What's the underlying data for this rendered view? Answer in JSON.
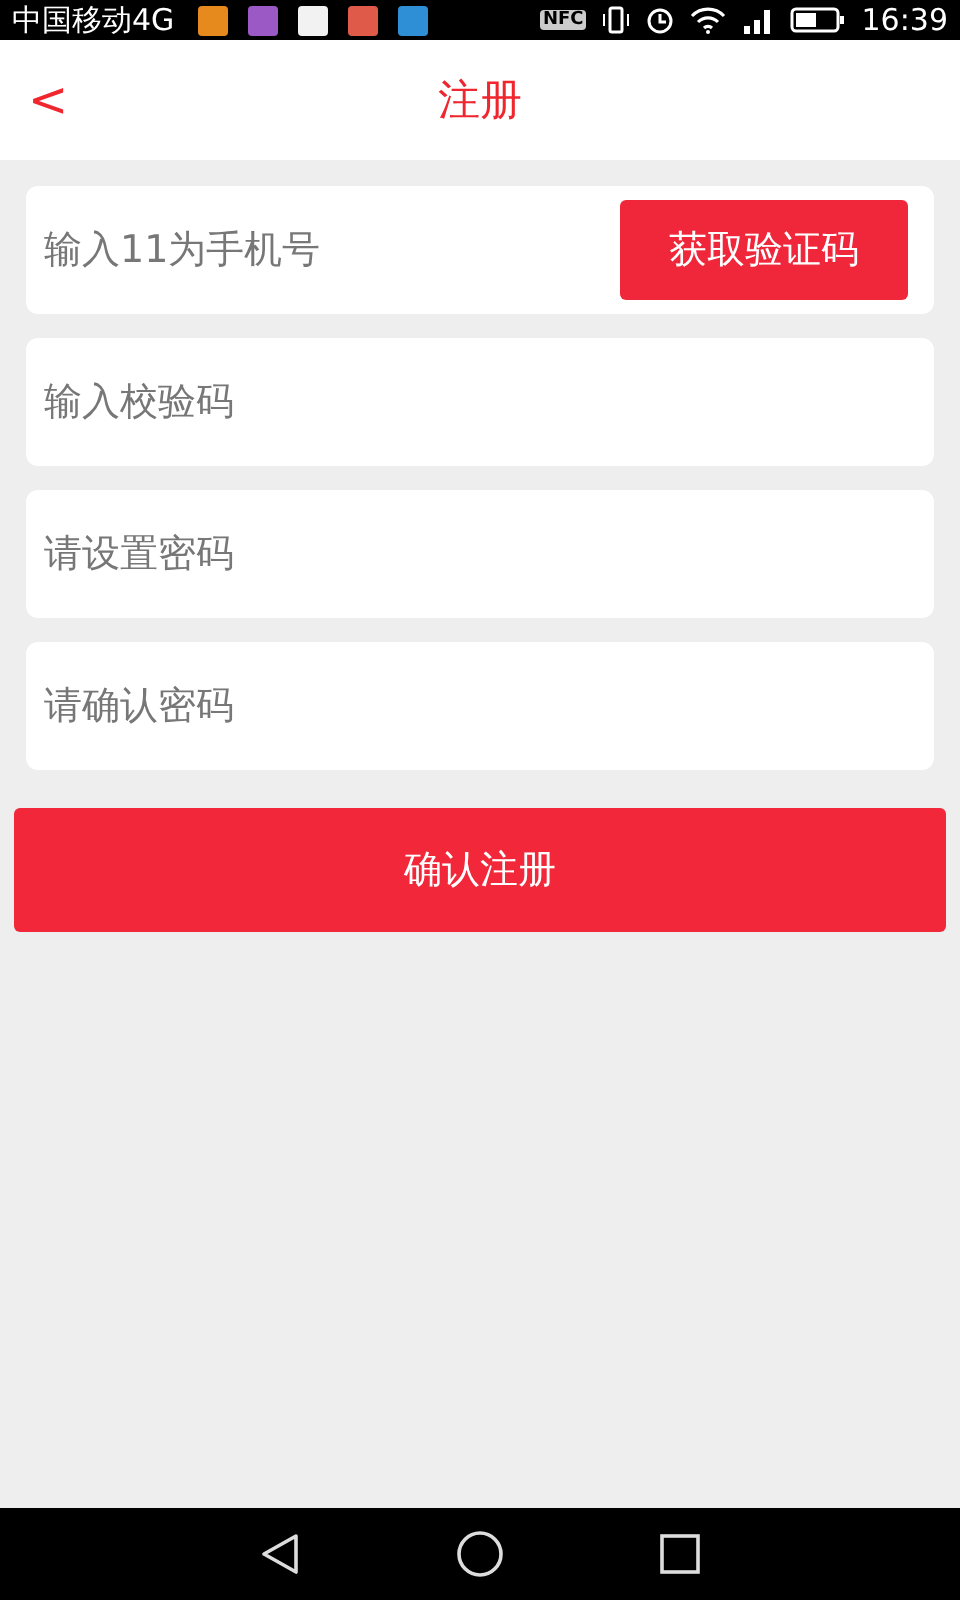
{
  "status_bar": {
    "carrier": "中国移动4G",
    "app_icons": [
      {
        "color": "#e68a1e"
      },
      {
        "color": "#9b59c6"
      },
      {
        "color": "#f2f2f2"
      },
      {
        "color": "#e05a4a"
      },
      {
        "color": "#2f8fd6"
      }
    ],
    "nfc": "NFC",
    "time": "16:39"
  },
  "header": {
    "back": "<",
    "title": "注册"
  },
  "fields": [
    {
      "placeholder": "输入11为手机号",
      "button": "获取验证码"
    },
    {
      "placeholder": "输入校验码"
    },
    {
      "placeholder": "请设置密码"
    },
    {
      "placeholder": "请确认密码"
    }
  ],
  "submit": "确认注册"
}
